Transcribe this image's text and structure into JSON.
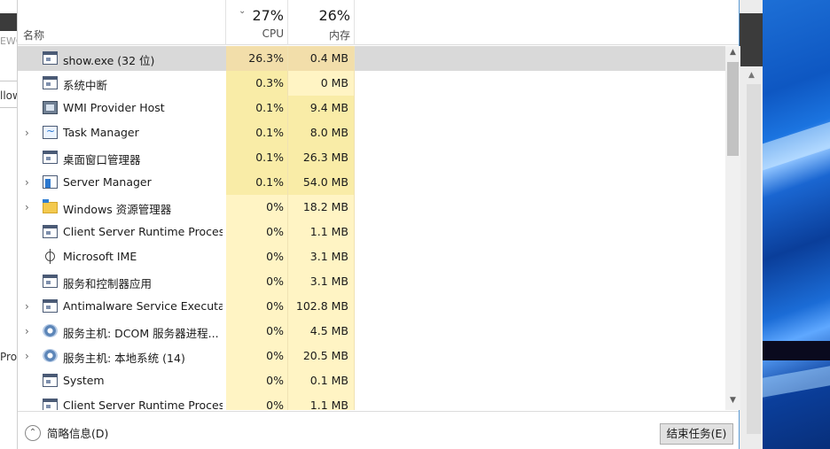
{
  "background_window": {
    "text_top": "EWC",
    "text_mid": "llow",
    "text_bottom": "Pro"
  },
  "header": {
    "name_label": "名称",
    "cpu_percent": "27%",
    "cpu_label": "CPU",
    "mem_percent": "26%",
    "mem_label": "内存",
    "sort_icon": "chevron-down-icon"
  },
  "processes": [
    {
      "name": "show.exe (32 位)",
      "cpu": "26.3%",
      "mem": "0.4 MB",
      "expandable": false,
      "icon": "app-window-icon",
      "selected": true
    },
    {
      "name": "系统中断",
      "cpu": "0.3%",
      "mem": "0 MB",
      "expandable": false,
      "icon": "app-window-icon"
    },
    {
      "name": "WMI Provider Host",
      "cpu": "0.1%",
      "mem": "9.4 MB",
      "expandable": false,
      "icon": "wmi-icon"
    },
    {
      "name": "Task Manager",
      "cpu": "0.1%",
      "mem": "8.0 MB",
      "expandable": true,
      "icon": "task-manager-icon"
    },
    {
      "name": "桌面窗口管理器",
      "cpu": "0.1%",
      "mem": "26.3 MB",
      "expandable": false,
      "icon": "app-window-icon"
    },
    {
      "name": "Server Manager",
      "cpu": "0.1%",
      "mem": "54.0 MB",
      "expandable": true,
      "icon": "server-manager-icon"
    },
    {
      "name": "Windows 资源管理器",
      "cpu": "0%",
      "mem": "18.2 MB",
      "expandable": true,
      "icon": "folder-icon"
    },
    {
      "name": "Client Server Runtime Process",
      "cpu": "0%",
      "mem": "1.1 MB",
      "expandable": false,
      "icon": "app-window-icon"
    },
    {
      "name": "Microsoft IME",
      "cpu": "0%",
      "mem": "3.1 MB",
      "expandable": false,
      "icon": "ime-icon"
    },
    {
      "name": "服务和控制器应用",
      "cpu": "0%",
      "mem": "3.1 MB",
      "expandable": false,
      "icon": "app-window-icon"
    },
    {
      "name": "Antimalware Service Executa...",
      "cpu": "0%",
      "mem": "102.8 MB",
      "expandable": true,
      "icon": "app-window-icon"
    },
    {
      "name": "服务主机: DCOM 服务器进程...",
      "cpu": "0%",
      "mem": "4.5 MB",
      "expandable": true,
      "icon": "gear-icon"
    },
    {
      "name": "服务主机: 本地系统 (14)",
      "cpu": "0%",
      "mem": "20.5 MB",
      "expandable": true,
      "icon": "gear-icon"
    },
    {
      "name": "System",
      "cpu": "0%",
      "mem": "0.1 MB",
      "expandable": false,
      "icon": "app-window-icon"
    },
    {
      "name": "Client Server Runtime Process",
      "cpu": "0%",
      "mem": "1.1 MB",
      "expandable": false,
      "icon": "app-window-icon"
    }
  ],
  "footer": {
    "fewer_details_label": "简略信息(D)",
    "end_task_label": "结束任务(E)"
  },
  "colors": {
    "heat_high": "#f9eca7",
    "heat_low": "#fff4c4",
    "selected_row": "#d9d9d9",
    "window_border": "#5b9bd5"
  }
}
